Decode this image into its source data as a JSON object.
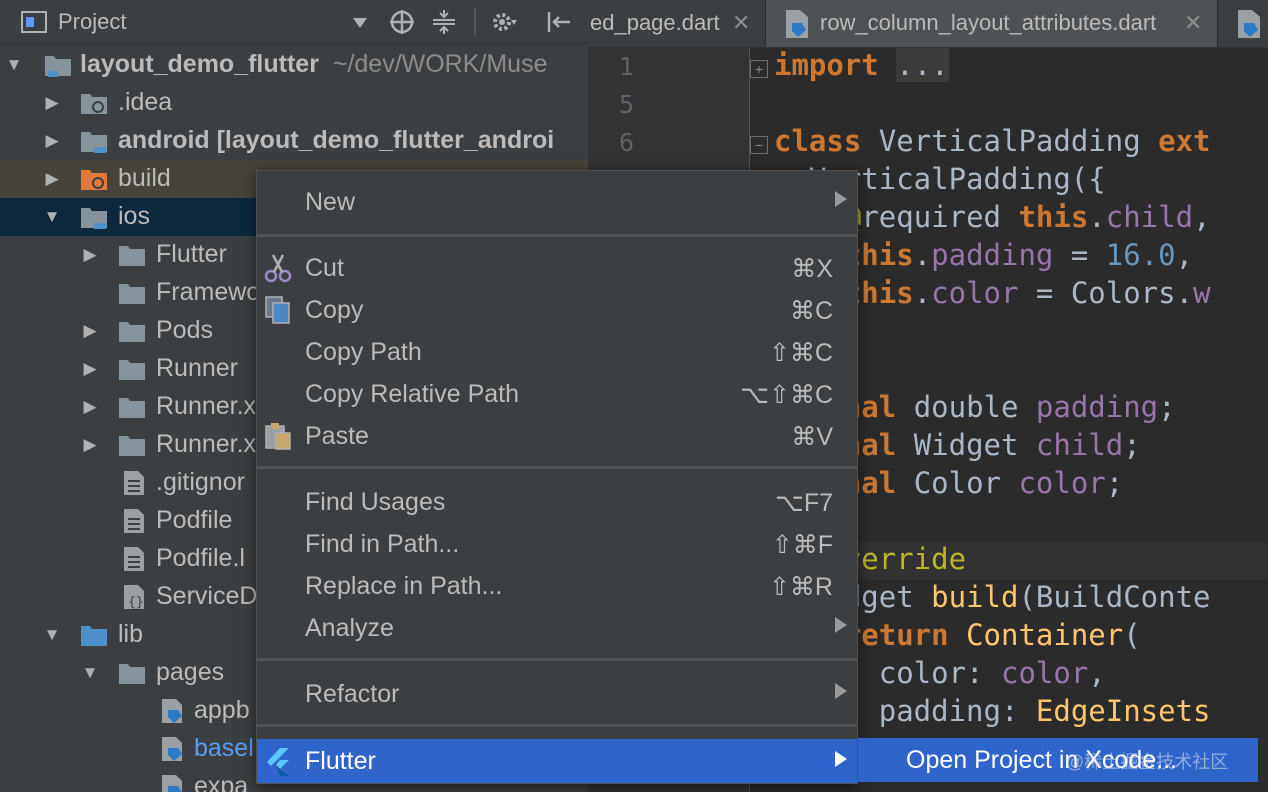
{
  "panel": {
    "title": "Project",
    "tree": [
      {
        "label": "layout_demo_flutter",
        "path": "~/dev/WORK/Muse",
        "icon": "module-folder-icon",
        "arrow": "expanded"
      },
      {
        "label": ".idea",
        "icon": "settings-folder-icon",
        "arrow": "collapsed"
      },
      {
        "label": "android [layout_demo_flutter_androi",
        "icon": "module-folder-icon",
        "arrow": "collapsed"
      },
      {
        "label": "build",
        "icon": "excluded-folder-icon",
        "arrow": "collapsed"
      },
      {
        "label": "ios",
        "icon": "module-folder-icon",
        "arrow": "expanded"
      },
      {
        "label": "Flutter",
        "icon": "folder-icon",
        "arrow": "collapsed"
      },
      {
        "label": "Framewo",
        "icon": "folder-icon",
        "arrow": "none"
      },
      {
        "label": "Pods",
        "icon": "folder-icon",
        "arrow": "collapsed"
      },
      {
        "label": "Runner",
        "icon": "folder-icon",
        "arrow": "collapsed"
      },
      {
        "label": "Runner.x",
        "icon": "folder-icon",
        "arrow": "collapsed"
      },
      {
        "label": "Runner.x",
        "icon": "folder-icon",
        "arrow": "collapsed"
      },
      {
        "label": ".gitignor",
        "icon": "text-file-icon",
        "arrow": "none"
      },
      {
        "label": "Podfile",
        "icon": "text-file-icon",
        "arrow": "none"
      },
      {
        "label": "Podfile.l",
        "icon": "text-file-icon",
        "arrow": "none"
      },
      {
        "label": "ServiceD",
        "icon": "json-file-icon",
        "arrow": "none"
      },
      {
        "label": "lib",
        "icon": "source-folder-icon",
        "arrow": "expanded"
      },
      {
        "label": "pages",
        "icon": "folder-icon",
        "arrow": "expanded"
      },
      {
        "label": "appb",
        "icon": "dart-file-icon",
        "arrow": "none"
      },
      {
        "label": "basel",
        "icon": "dart-file-icon",
        "arrow": "none"
      },
      {
        "label": "expa",
        "icon": "dart-file-icon",
        "arrow": "none"
      }
    ]
  },
  "tabs": [
    {
      "label": "ed_page.dart",
      "close": "✕"
    },
    {
      "label": "row_column_layout_attributes.dart",
      "close": "✕"
    }
  ],
  "editor": {
    "line_numbers": [
      "1",
      "5",
      "6"
    ]
  },
  "menu": {
    "new": "New",
    "cut": "Cut",
    "cut_sc": "⌘X",
    "copy": "Copy",
    "copy_sc": "⌘C",
    "copy_path": "Copy Path",
    "copy_path_sc": "⇧⌘C",
    "copy_rel": "Copy Relative Path",
    "copy_rel_sc": "⌥⇧⌘C",
    "paste": "Paste",
    "paste_sc": "⌘V",
    "find_usages": "Find Usages",
    "find_usages_sc": "⌥F7",
    "find_in_path": "Find in Path...",
    "find_in_path_sc": "⇧⌘F",
    "replace_in_path": "Replace in Path...",
    "replace_in_path_sc": "⇧⌘R",
    "analyze": "Analyze",
    "refactor": "Refactor",
    "flutter": "Flutter"
  },
  "submenu": {
    "open_xcode": "Open Project in Xcode..."
  },
  "watermark": "@稀土掘金技术社区",
  "colors": {
    "selection": "#2f65ca",
    "keyword": "#cc7832",
    "field": "#9876aa",
    "number": "#6897bb",
    "function": "#ffc66d"
  }
}
